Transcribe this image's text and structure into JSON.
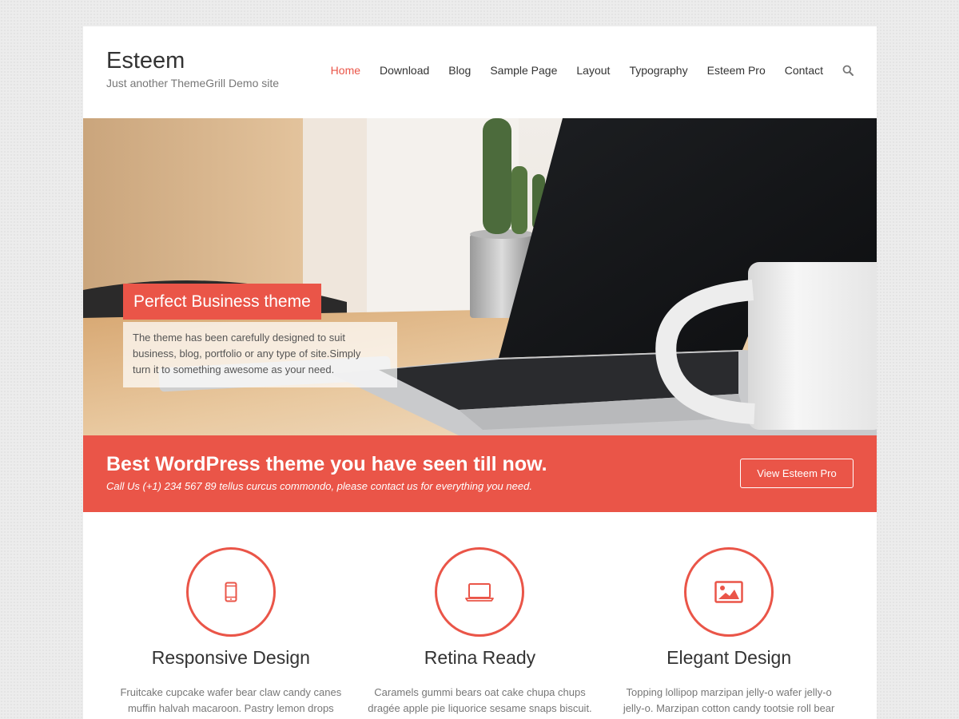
{
  "site": {
    "title": "Esteem",
    "description": "Just another ThemeGrill Demo site"
  },
  "nav": {
    "items": [
      "Home",
      "Download",
      "Blog",
      "Sample Page",
      "Layout",
      "Typography",
      "Esteem Pro",
      "Contact"
    ],
    "active": "Home",
    "search_icon": "search-icon"
  },
  "hero": {
    "caption_title": "Perfect Business theme",
    "caption_lines": [
      "The theme has been carefully designed to suit",
      "business, blog, portfolio or any type of site.Simply",
      "turn it to something awesome as your need."
    ]
  },
  "cta": {
    "title": "Best WordPress theme you have seen till now.",
    "subtitle": "Call Us (+1) 234 567 89 tellus curcus commondo, please contact us for everything you need.",
    "button_label": "View Esteem Pro"
  },
  "features": [
    {
      "icon": "mobile-icon",
      "title": "Responsive Design",
      "lines": [
        "Fruitcake cupcake wafer bear claw candy canes",
        "muffin halvah macaroon. Pastry lemon drops"
      ]
    },
    {
      "icon": "laptop-icon",
      "title": "Retina Ready",
      "lines": [
        "Caramels gummi bears oat cake chupa chups",
        "dragée apple pie liquorice sesame snaps biscuit."
      ]
    },
    {
      "icon": "image-icon",
      "title": "Elegant Design",
      "lines": [
        "Topping lollipop marzipan jelly-o wafer jelly-o",
        "jelly-o. Marzipan cotton candy tootsie roll bear"
      ]
    }
  ],
  "colors": {
    "accent": "#ea5548",
    "background": "#ececec",
    "text": "#333333",
    "muted": "#777777"
  }
}
